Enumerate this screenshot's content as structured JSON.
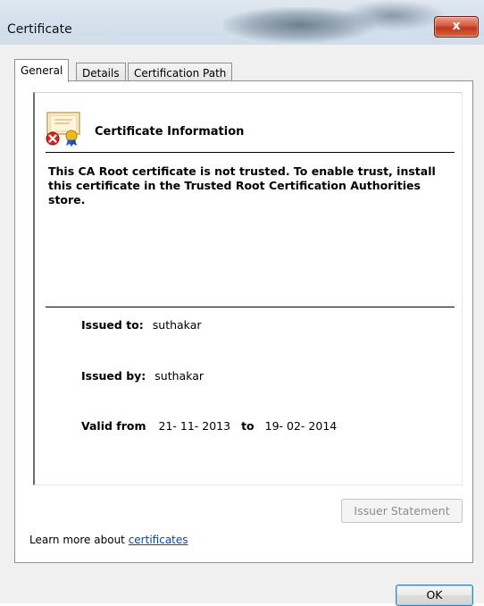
{
  "window": {
    "title": "Certificate",
    "close_label": "x"
  },
  "tabs": [
    {
      "label": "General",
      "active": true
    },
    {
      "label": "Details",
      "active": false
    },
    {
      "label": "Certification Path",
      "active": false
    }
  ],
  "info": {
    "heading": "Certificate Information",
    "message": "This CA Root certificate is not trusted. To enable trust, install this certificate in the Trusted Root Certification Authorities store.",
    "icon": "certificate-error-icon"
  },
  "details": {
    "issued_to_label": "Issued to:",
    "issued_to_value": "suthakar",
    "issued_by_label": "Issued by:",
    "issued_by_value": "suthakar",
    "valid_from_label": "Valid from",
    "valid_from_value": "21- 11- 2013",
    "to_label": "to",
    "valid_to_value": "19- 02- 2014"
  },
  "buttons": {
    "issuer_statement": "Issuer Statement",
    "ok": "OK"
  },
  "footer": {
    "learn_prefix": "Learn more about ",
    "learn_link": "certificates"
  },
  "colors": {
    "link": "#0645ad",
    "close_button": "#c1351b"
  }
}
